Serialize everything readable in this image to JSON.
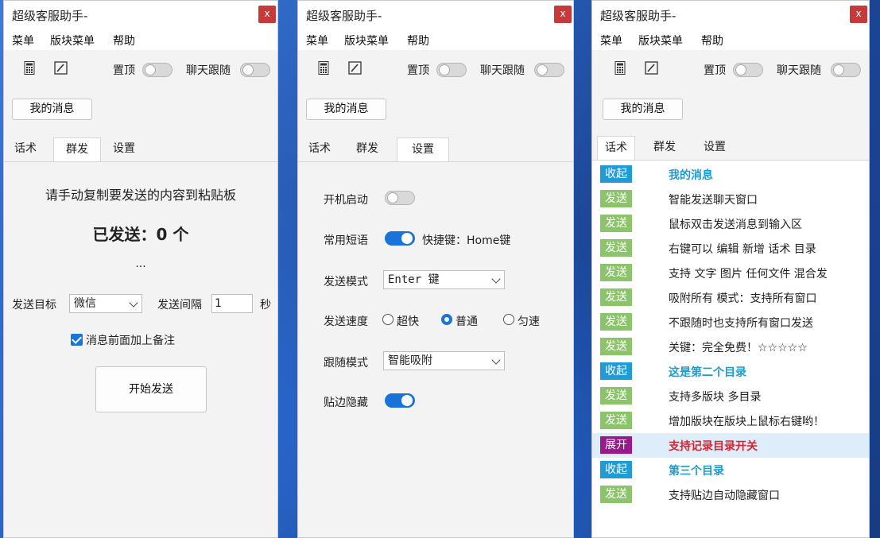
{
  "windows": [
    {
      "title": "超级客服助手-",
      "close": "x",
      "menu": [
        "菜单",
        "版块菜单",
        "帮助"
      ],
      "toolbar": {
        "pin_label": "置顶",
        "follow_label": "聊天跟随"
      },
      "my_messages": "我的消息",
      "tabs": [
        "话术",
        "群发",
        "设置"
      ],
      "active_tab": "群发",
      "mass": {
        "instruction": "请手动复制要发送的内容到粘贴板",
        "sent_status": "已发送：0 个",
        "ellipsis": "...",
        "target_label": "发送目标",
        "target_value": "微信",
        "interval_label": "发送间隔",
        "interval_value": "1",
        "interval_unit": "秒",
        "note_label": "消息前面加上备注",
        "start_button": "开始发送"
      }
    },
    {
      "title": "超级客服助手-",
      "close": "x",
      "menu": [
        "菜单",
        "版块菜单",
        "帮助"
      ],
      "toolbar": {
        "pin_label": "置顶",
        "follow_label": "聊天跟随"
      },
      "my_messages": "我的消息",
      "tabs": [
        "话术",
        "群发",
        "设置"
      ],
      "active_tab": "设置",
      "settings": {
        "autostart_label": "开机启动",
        "phrases_label": "常用短语",
        "hotkey_text": "快捷键：Home键",
        "send_mode_label": "发送模式",
        "send_mode_value": "Enter 键",
        "speed_label": "发送速度",
        "speed_options": [
          "超快",
          "普通",
          "匀速"
        ],
        "speed_selected": "普通",
        "follow_mode_label": "跟随模式",
        "follow_mode_value": "智能吸附",
        "edge_hide_label": "贴边隐藏"
      }
    },
    {
      "title": "超级客服助手-",
      "close": "x",
      "menu": [
        "菜单",
        "版块菜单",
        "帮助"
      ],
      "toolbar": {
        "pin_label": "置顶",
        "follow_label": "聊天跟随"
      },
      "my_messages": "我的消息",
      "tabs": [
        "话术",
        "群发",
        "设置"
      ],
      "active_tab": "话术",
      "scripts": [
        {
          "tag": "收起",
          "kind": "fold",
          "text": "我的消息",
          "style": "cat"
        },
        {
          "tag": "发送",
          "kind": "send",
          "text": "智能发送聊天窗口",
          "style": ""
        },
        {
          "tag": "发送",
          "kind": "send",
          "text": "鼠标双击发送消息到输入区",
          "style": ""
        },
        {
          "tag": "发送",
          "kind": "send",
          "text": "右键可以 编辑 新增 话术 目录",
          "style": ""
        },
        {
          "tag": "发送",
          "kind": "send",
          "text": "支持 文字 图片 任何文件 混合发",
          "style": ""
        },
        {
          "tag": "发送",
          "kind": "send",
          "text": "吸附所有 模式：支持所有窗口",
          "style": ""
        },
        {
          "tag": "发送",
          "kind": "send",
          "text": "不跟随时也支持所有窗口发送",
          "style": ""
        },
        {
          "tag": "发送",
          "kind": "send",
          "text": "关键：完全免费！☆☆☆☆☆",
          "style": ""
        },
        {
          "tag": "收起",
          "kind": "fold",
          "text": "这是第二个目录",
          "style": "cat"
        },
        {
          "tag": "发送",
          "kind": "send",
          "text": "支持多版块 多目录",
          "style": ""
        },
        {
          "tag": "发送",
          "kind": "send",
          "text": "增加版块在版块上鼠标右键哟！",
          "style": ""
        },
        {
          "tag": "展开",
          "kind": "open",
          "text": "支持记录目录开关",
          "style": "red"
        },
        {
          "tag": "收起",
          "kind": "fold",
          "text": "第三个目录",
          "style": "cat"
        },
        {
          "tag": "发送",
          "kind": "send",
          "text": "支持贴边自动隐藏窗口",
          "style": ""
        }
      ]
    }
  ]
}
